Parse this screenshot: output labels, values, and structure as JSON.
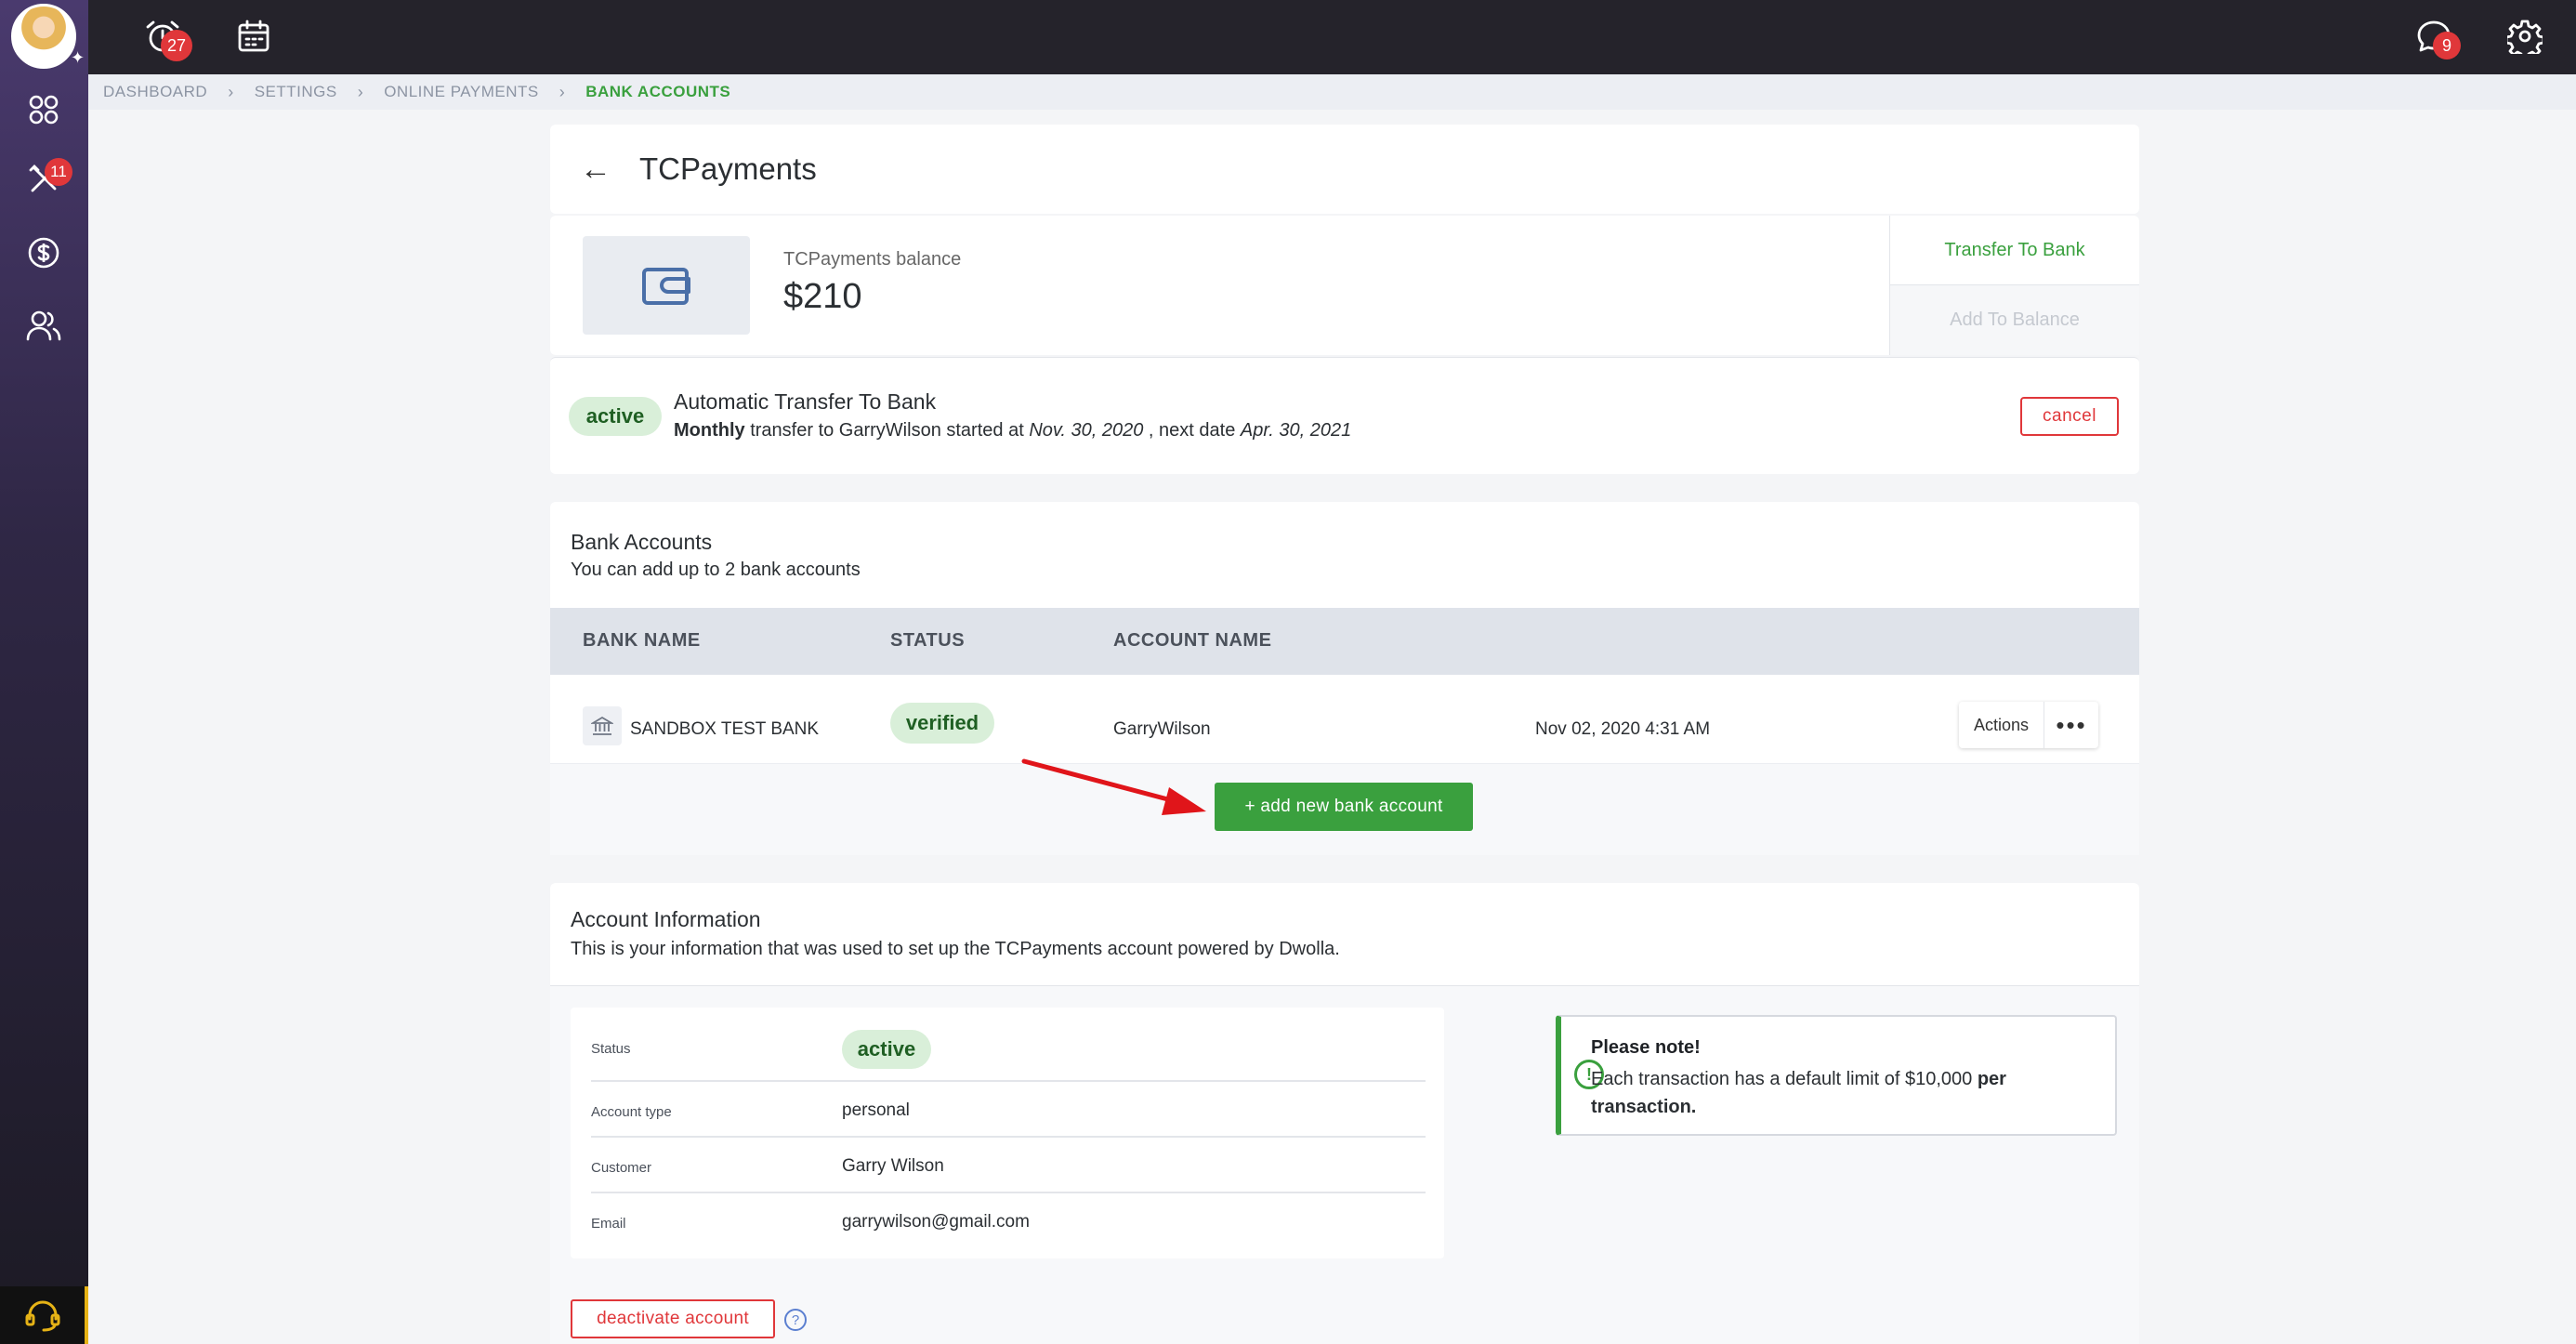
{
  "sidebar": {
    "badge_tools": "11",
    "icons": [
      "apps-icon",
      "tools-icon",
      "dollar-icon",
      "users-icon",
      "headset-icon"
    ]
  },
  "topbar": {
    "alarm_badge": "27",
    "chat_badge": "9"
  },
  "breadcrumb": {
    "items": [
      "DASHBOARD",
      "SETTINGS",
      "ONLINE PAYMENTS",
      "BANK ACCOUNTS"
    ]
  },
  "page": {
    "title": "TCPayments"
  },
  "balance": {
    "label": "TCPayments balance",
    "value": "$210",
    "transfer_label": "Transfer To Bank",
    "add_label": "Add To Balance"
  },
  "auto_transfer": {
    "status": "active",
    "title": "Automatic Transfer To Bank",
    "frequency": "Monthly",
    "text1": " transfer to GarryWilson started at ",
    "start_date": "Nov. 30, 2020",
    "text2": " , next date ",
    "next_date": "Apr. 30, 2021",
    "cancel_label": "cancel"
  },
  "bank_accounts": {
    "title": "Bank Accounts",
    "subtitle": "You can add up to 2 bank accounts",
    "columns": [
      "BANK NAME",
      "STATUS",
      "ACCOUNT NAME"
    ],
    "rows": [
      {
        "bank_name": "SANDBOX TEST BANK",
        "status": "verified",
        "account_name": "GarryWilson",
        "date": "Nov 02, 2020 4:31 AM",
        "actions_label": "Actions",
        "more": "•••"
      }
    ],
    "add_label": "+ add new bank account"
  },
  "account_info": {
    "title": "Account Information",
    "subtitle": "This is your information that was used to set up the TCPayments account powered by Dwolla.",
    "fields": [
      {
        "label": "Status",
        "value": "active"
      },
      {
        "label": "Account type",
        "value": "personal"
      },
      {
        "label": "Customer",
        "value": "Garry Wilson"
      },
      {
        "label": "Email",
        "value": "garrywilson@gmail.com"
      }
    ],
    "note_title": "Please note!",
    "note_text1": "Each transaction has a default limit of $10,000 ",
    "note_text2": "per transaction.",
    "deactivate_label": "deactivate account",
    "help_symbol": "?"
  },
  "colors": {
    "accent_green": "#3aa03e",
    "danger_red": "#e0373a",
    "sidebar_top": "#4a3a6e",
    "topbar": "#25232b"
  }
}
